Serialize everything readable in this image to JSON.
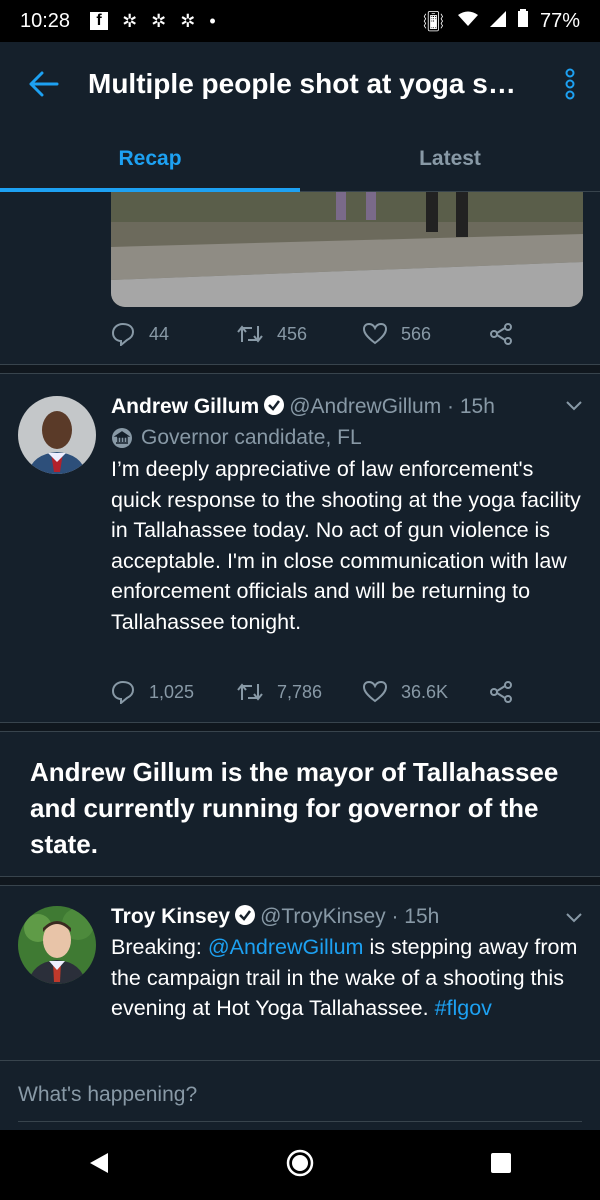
{
  "status_bar": {
    "time": "10:28",
    "battery": "77%"
  },
  "app_bar": {
    "title": "Multiple people shot at yoga st..."
  },
  "tabs": [
    {
      "label": "Recap",
      "active": true
    },
    {
      "label": "Latest",
      "active": false
    }
  ],
  "tweet0": {
    "replies": "44",
    "retweets": "456",
    "likes": "566"
  },
  "tweet1": {
    "name": "Andrew Gillum",
    "handle": "@AndrewGillum · 15h",
    "label": "Governor candidate, FL",
    "text": "I’m deeply appreciative of law enforcement's quick response to the shooting at the yoga facility in Tallahassee today. No act of gun violence is acceptable. I'm in close communication with law enforcement officials and will be returning to Tallahassee tonight.",
    "replies": "1,025",
    "retweets": "7,786",
    "likes": "36.6K"
  },
  "summary": "Andrew Gillum is the mayor of Tallahassee and currently running for governor of the state.",
  "tweet2": {
    "name": "Troy Kinsey",
    "handle": "@TroyKinsey · 15h",
    "text_prefix": "Breaking: ",
    "mention": "@AndrewGillum",
    "text_mid": " is stepping away from the campaign trail in the wake of a shooting this evening at Hot Yoga Tallahassee. ",
    "hashtag": "#flgov"
  },
  "composer": {
    "placeholder": "What's happening?"
  },
  "colors": {
    "accent": "#1da1f2",
    "background": "#15202b",
    "muted": "#8899a6"
  }
}
